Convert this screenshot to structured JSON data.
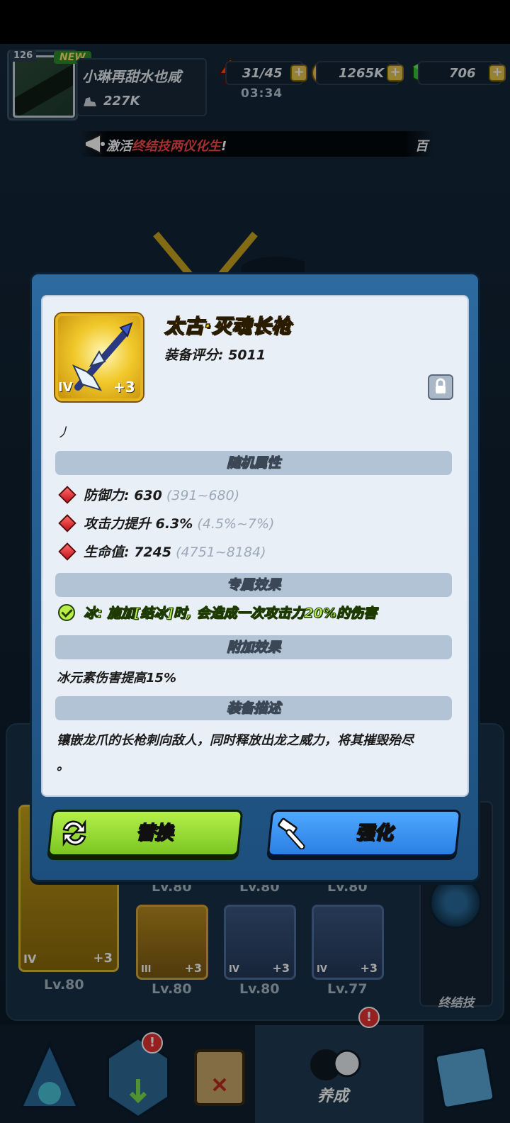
{
  "header": {
    "player_level": "126",
    "new_badge": "NEW",
    "player_name": "小琳再甜水也咸",
    "power": "227K",
    "energy": "31/45",
    "energy_timer": "03:34",
    "coins": "1265K",
    "gems": "706"
  },
  "notice": {
    "prefix": "激活",
    "highlight": "终结技两仪化生",
    "suffix": "!",
    "tail": "百"
  },
  "item": {
    "name": "太古·灭魂长枪",
    "score_label": "装备评分: 5011",
    "tier": "IV",
    "plus": "+3",
    "stray_text": "丿"
  },
  "sections": {
    "random_attrs": "随机属性",
    "exclusive": "专属效果",
    "extra": "附加效果",
    "description": "装备描述"
  },
  "attributes": [
    {
      "label": "防御力: 630",
      "range": "(391~680)"
    },
    {
      "label": "攻击力提升 6.3%",
      "range": "(4.5%~7%)"
    },
    {
      "label": "生命值: 7245",
      "range": "(4751~8184)"
    }
  ],
  "exclusive_effect": "冰: 施加[结冰]时, 会造成一次攻击力20%的伤害",
  "extra_effect": "冰元素伤害提高15%",
  "description": {
    "line1": "镶嵌龙爪的长枪刺向敌人，同时释放出龙之威力，将其摧毁殆尽",
    "line2": "。"
  },
  "buttons": {
    "replace": "替换",
    "enhance": "强化"
  },
  "equipment": {
    "top_levels": [
      "Lv.80",
      "Lv.80",
      "Lv.80"
    ],
    "weapon_level": "Lv.80",
    "weapon_tier": "IV",
    "weapon_plus": "+3",
    "slots": [
      {
        "tier": "III",
        "plus": "+3",
        "level": "Lv.80"
      },
      {
        "tier": "IV",
        "plus": "+3",
        "level": "Lv.80"
      },
      {
        "tier": "IV",
        "plus": "+3",
        "level": "Lv.77"
      }
    ],
    "ultimate_label": "终结技"
  },
  "nav": {
    "active_label": "养成",
    "badge": "!"
  }
}
